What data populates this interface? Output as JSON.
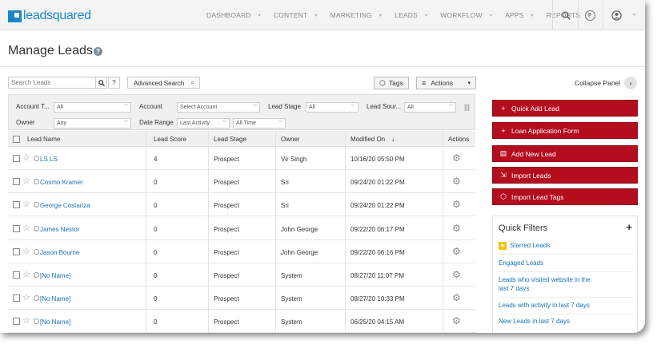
{
  "header": {
    "logo_text": "leadsquared",
    "nav": [
      "DASHBOARD",
      "CONTENT",
      "MARKETING",
      "LEADS",
      "WORKFLOW",
      "APPS",
      "REPORTS"
    ],
    "icons": [
      "search-icon",
      "help-icon",
      "user-icon"
    ]
  },
  "page": {
    "title": "Manage Leads",
    "help_glyph": "?"
  },
  "toolbar": {
    "search_placeholder": "Search Leads",
    "search_help": "?",
    "advanced_search": "Advanced Search",
    "tags": "Tags",
    "actions": "Actions",
    "collapse_panel": "Collapse Panel"
  },
  "filters": {
    "account_type_label": "Account T...",
    "account_type_value": "All",
    "account_label": "Account",
    "account_value": "Select Account",
    "lead_stage_label": "Lead Stage",
    "lead_stage_value": "All",
    "lead_source_label": "Lead Sour...",
    "lead_source_value": "All",
    "owner_label": "Owner",
    "owner_value": "Any",
    "date_range_label": "Date Range",
    "date_range_value": "Last Activity",
    "date_period_value": "All Time"
  },
  "table": {
    "columns": [
      "Lead Name",
      "Lead Score",
      "Lead Stage",
      "Owner",
      "Modified On",
      "Actions"
    ],
    "sort_indicator": "↓",
    "rows": [
      {
        "name": "LS LS",
        "score": "4",
        "stage": "Prospect",
        "owner": "Vir Singh",
        "modified": "10/16/20 05:50 PM"
      },
      {
        "name": "Cosmo Kramer",
        "score": "0",
        "stage": "Prospect",
        "owner": "Sri",
        "modified": "09/24/20 01:22 PM"
      },
      {
        "name": "George Costanza",
        "score": "0",
        "stage": "Prospect",
        "owner": "Sri",
        "modified": "09/24/20 01:22 PM"
      },
      {
        "name": "James Nestor",
        "score": "0",
        "stage": "Prospect",
        "owner": "John George",
        "modified": "09/22/20 06:17 PM"
      },
      {
        "name": "Jason Bourne",
        "score": "0",
        "stage": "Prospect",
        "owner": "John George",
        "modified": "09/22/20 06:16 PM"
      },
      {
        "name": "[No Name]",
        "score": "0",
        "stage": "Prospect",
        "owner": "System",
        "modified": "08/27/20 11:07 PM"
      },
      {
        "name": "[No Name]",
        "score": "0",
        "stage": "Prospect",
        "owner": "System",
        "modified": "08/27/20 10:33 PM"
      },
      {
        "name": "[No Name]",
        "score": "0",
        "stage": "Prospect",
        "owner": "System",
        "modified": "06/25/20 04:15 AM"
      }
    ]
  },
  "side_panel": {
    "buttons": [
      "Quick Add Lead",
      "Loan Application Form",
      "Add New Lead",
      "Import Leads",
      "Import Lead Tags"
    ],
    "quick_filters_title": "Quick Filters",
    "quick_filters": [
      "Starred Leads",
      "Engaged Leads",
      "Leads who visited website in the last 7 days",
      "Leads with activity in last 7 days",
      "New Leads in last 7 days"
    ]
  },
  "colors": {
    "brand_blue": "#1a86c8",
    "primary_red": "#b40d1e",
    "link_blue": "#1a73b8"
  }
}
